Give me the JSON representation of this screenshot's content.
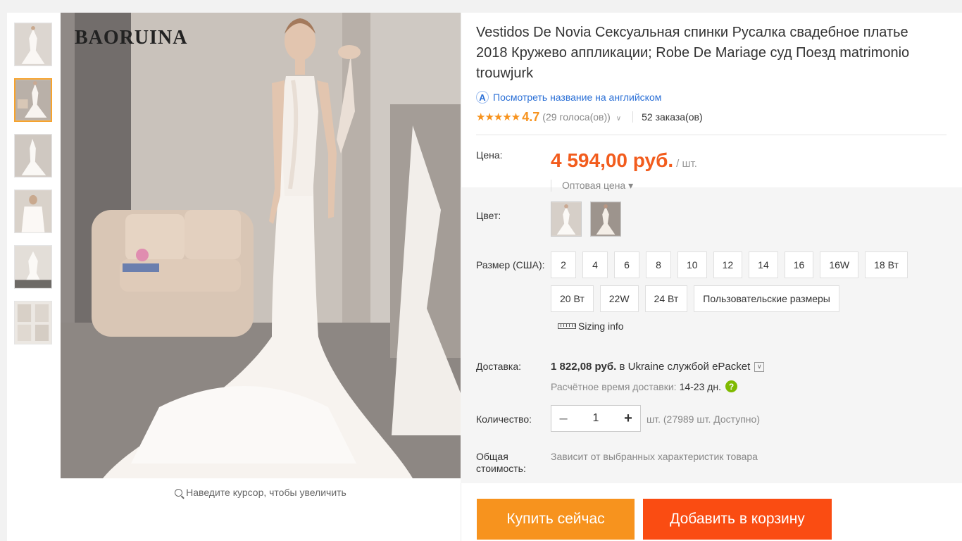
{
  "product": {
    "title": "Vestidos De Novia Сексуальная спинки Русалка свадебное платье 2018 Кружево аппликации; Robe De Mariage суд Поезд matrimonio trouwjurk",
    "translate_link": "Посмотреть название на английском",
    "rating": {
      "stars": "★★★★★",
      "value": "4.7",
      "votes": "(29 голоса(ов))",
      "orders": "52 заказа(ов)"
    },
    "brand_watermark": "BAORUINA",
    "zoom_hint": "Наведите курсор, чтобы увеличить"
  },
  "price": {
    "label": "Цена:",
    "amount": "4 594,00 руб.",
    "unit": "/ шт.",
    "wholesale": "Оптовая цена ▾"
  },
  "color": {
    "label": "Цвет:"
  },
  "size": {
    "label": "Размер (США):",
    "options": [
      "2",
      "4",
      "6",
      "8",
      "10",
      "12",
      "14",
      "16",
      "16W",
      "18 Вт",
      "20 Вт",
      "22W",
      "24 Вт",
      "Пользовательские размеры"
    ],
    "sizing_info": "Sizing info"
  },
  "shipping": {
    "label": "Доставка:",
    "cost": "1 822,08 руб.",
    "to_text": "в Ukraine службой ePacket",
    "estimate_label": "Расчётное время доставки:",
    "estimate_days": "14-23 дн."
  },
  "quantity": {
    "label": "Количество:",
    "value": "1",
    "available": "шт. (27989 шт. Доступно)"
  },
  "total": {
    "label": "Общая стоимость:",
    "value": "Зависит от выбранных характеристик товара"
  },
  "actions": {
    "buy_now": "Купить сейчас",
    "add_to_cart": "Добавить в корзину"
  },
  "colors": {
    "price": "#f25c1d",
    "buy": "#f7931e",
    "cart": "#fa4c12",
    "link": "#2a6fd6",
    "star": "#f7931e"
  }
}
